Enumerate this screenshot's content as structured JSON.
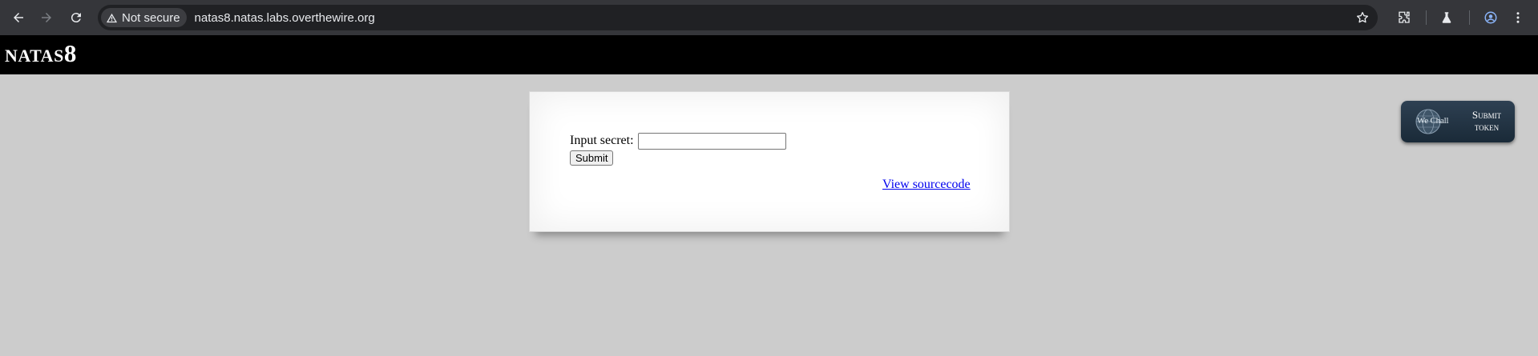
{
  "browser": {
    "security_label": "Not secure",
    "url": "natas8.natas.labs.overthewire.org",
    "icons": [
      "back-arrow-icon",
      "forward-arrow-icon",
      "reload-icon",
      "warning-triangle-icon",
      "star-icon",
      "extensions-icon",
      "labs-flask-icon",
      "profile-icon",
      "kebab-menu-icon"
    ]
  },
  "header": {
    "title_prefix": "NATAS",
    "title_number": "8"
  },
  "form": {
    "secret_label": "Input secret:",
    "secret_value": "",
    "submit_label": "Submit"
  },
  "links": {
    "view_source": "View sourcecode"
  },
  "wechall": {
    "logo_text": "We Chall",
    "submit_line1": "Submit",
    "submit_line2": "token"
  },
  "colors": {
    "page_background": "#cccccc",
    "header_background": "#000000",
    "toolbar_background": "#35363a",
    "omnibox_background": "#202124",
    "link": "#0000ee"
  }
}
